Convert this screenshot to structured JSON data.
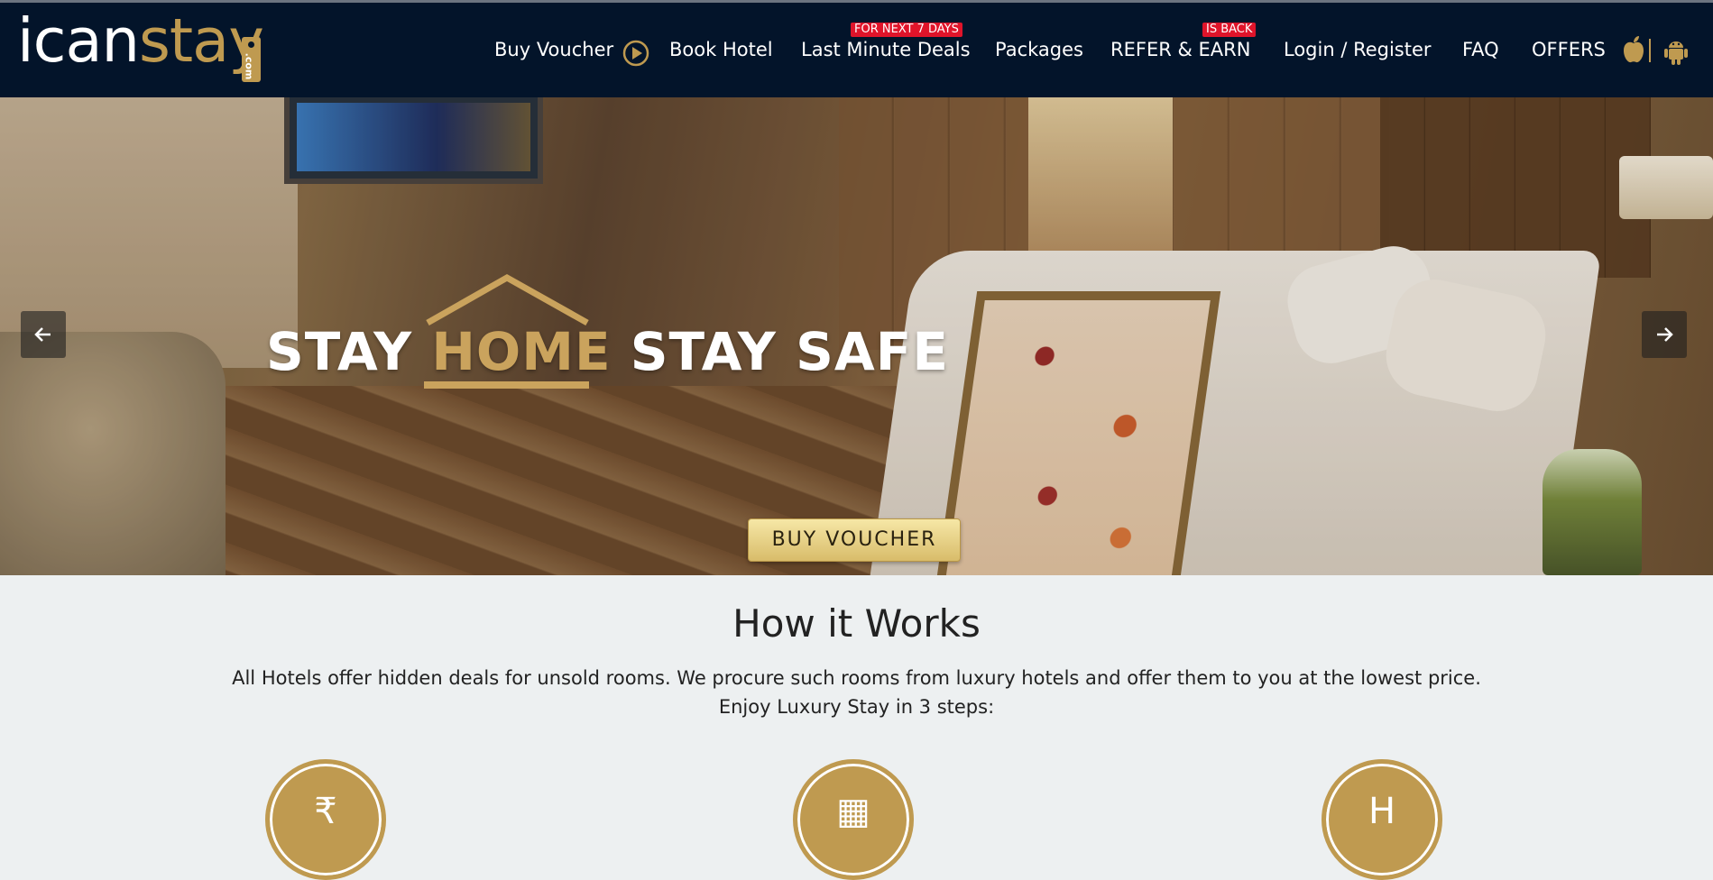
{
  "header": {
    "logo": {
      "main": "ican",
      "accent": "stay",
      "tag": ".com"
    },
    "nav": [
      {
        "label": "Buy Voucher"
      },
      {
        "label": "Book Hotel"
      },
      {
        "label": "Last Minute Deals",
        "badge": "FOR NEXT 7 DAYS"
      },
      {
        "label": "Packages"
      },
      {
        "label": "REFER & EARN",
        "badge": "IS BACK"
      },
      {
        "label": "Login / Register"
      },
      {
        "label": "FAQ"
      },
      {
        "label": "OFFERS"
      }
    ],
    "icons": {
      "play": "play-circle-icon",
      "apple": "apple-icon",
      "android": "android-icon"
    }
  },
  "hero": {
    "slogan": {
      "part1": "STAY ",
      "highlight": "HOME",
      "part2": " STAY SAFE"
    },
    "cta": "BUY VOUCHER",
    "prev": "arrow-left-icon",
    "next": "arrow-right-icon"
  },
  "how_it_works": {
    "title": "How it Works",
    "line1": "All Hotels offer hidden deals for unsold rooms. We procure such rooms from luxury hotels and offer them to you at the lowest price.",
    "line2": "Enjoy Luxury Stay in 3 steps:",
    "steps": [
      {
        "icon": "rupee-voucher-icon",
        "glyph": "₹"
      },
      {
        "icon": "calendar-icon",
        "glyph": "▦"
      },
      {
        "icon": "hotel-building-icon",
        "glyph": "H"
      }
    ]
  },
  "colors": {
    "navy": "#03142a",
    "gold": "#bf9a50",
    "badge_red": "#e0142a",
    "bg": "#edf0f1"
  }
}
